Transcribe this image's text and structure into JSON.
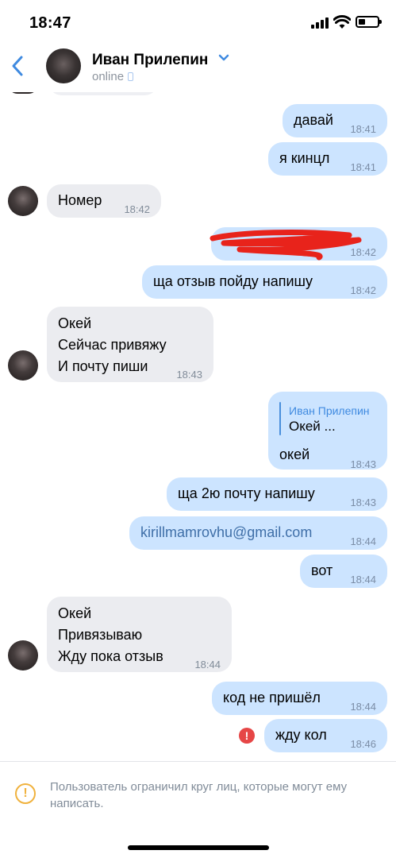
{
  "status_bar": {
    "time": "18:47"
  },
  "header": {
    "contact_name": "Иван Прилепин",
    "status": "online"
  },
  "messages": [
    {
      "direction": "out",
      "text": "давай",
      "time": "18:41"
    },
    {
      "direction": "out",
      "text": "я кинцл",
      "time": "18:41"
    },
    {
      "direction": "in",
      "text": "Номер",
      "time": "18:42"
    },
    {
      "direction": "out",
      "text": "",
      "time": "18:42",
      "redacted": true
    },
    {
      "direction": "out",
      "text": "ща отзыв пойду напишу",
      "time": "18:42"
    },
    {
      "direction": "in",
      "text": "Окей\nСейчас привяжу\nИ почту пиши",
      "time": "18:43"
    },
    {
      "direction": "out",
      "reply_name": "Иван Прилепин",
      "reply_text": "Окей ...",
      "text": "окей",
      "time": "18:43"
    },
    {
      "direction": "out",
      "text": "ща 2ю почту напишу",
      "time": "18:43"
    },
    {
      "direction": "out",
      "text": "kirillmamrovhu@gmail.com",
      "time": "18:44"
    },
    {
      "direction": "out",
      "text": "вот",
      "time": "18:44"
    },
    {
      "direction": "in",
      "text": "Окей\nПривязываю\nЖду пока отзыв",
      "time": "18:44"
    },
    {
      "direction": "out",
      "text": "код не пришёл",
      "time": "18:44"
    },
    {
      "direction": "out",
      "text": "жду кол",
      "time": "18:46",
      "error": true
    }
  ],
  "footer": {
    "notice": "Пользователь ограничил круг лиц, которые могут ему написать."
  },
  "colors": {
    "outgoing_bubble": "#cce4ff",
    "incoming_bubble": "#ebecf0",
    "accent": "#3f8ae0",
    "error": "#e64646",
    "warning": "#f0b23e"
  },
  "icons": [
    "back-icon",
    "chevron-down-icon",
    "phone-icon",
    "error-icon",
    "warning-icon"
  ]
}
